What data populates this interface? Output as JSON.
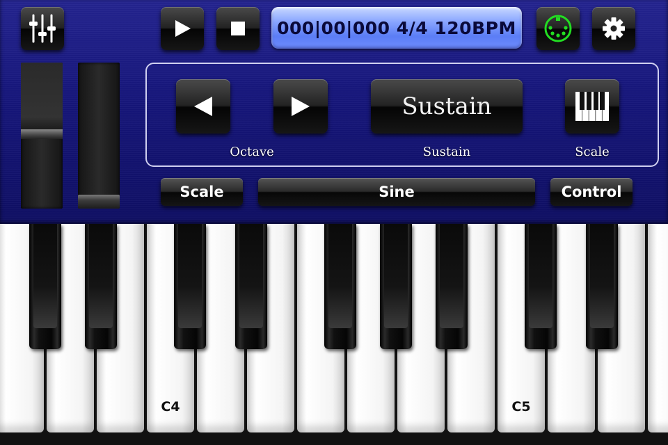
{
  "transport": {
    "mixer_icon": "mixer-sliders-icon",
    "play_icon": "play-icon",
    "stop_icon": "stop-icon",
    "position_display": "000|00|000 4/4 120BPM",
    "midi_icon": "midi-connector-icon",
    "midi_status_color": "#22dd22",
    "settings_icon": "gear-icon"
  },
  "controls": {
    "octave_down_icon": "arrow-left-icon",
    "octave_up_icon": "arrow-right-icon",
    "octave_label": "Octave",
    "sustain_button": "Sustain",
    "sustain_label": "Sustain",
    "scale_icon": "piano-keys-icon",
    "scale_label": "Scale"
  },
  "bar": {
    "scale_button": "Scale",
    "sound_button": "Sine",
    "control_button": "Control"
  },
  "sliders": [
    {
      "name": "volume-slider",
      "level": 0.5
    },
    {
      "name": "pitch-slider",
      "level": 0.04
    }
  ],
  "keyboard": {
    "white_key_labels": [
      "",
      "",
      "",
      "C4",
      "",
      "",
      "",
      "",
      "",
      "",
      "C5",
      "",
      "",
      ""
    ],
    "accent": "#15157a"
  }
}
